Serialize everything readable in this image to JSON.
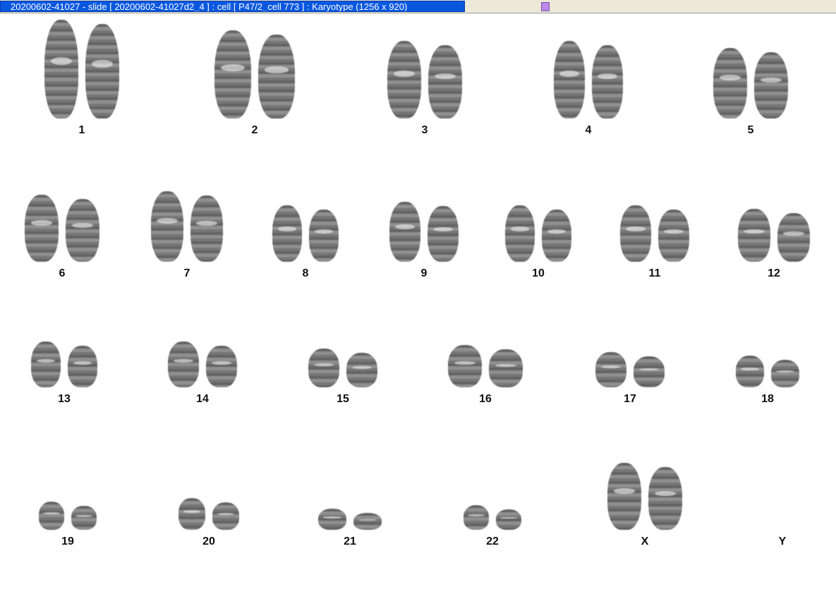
{
  "window": {
    "title": "20200602-41027 - slide [ 20200602-41027d2_4 ] : cell [ P47/2_cell 773 ] : Karyotype  (1256 x 920)"
  },
  "karyotype": {
    "labels": [
      "1",
      "2",
      "3",
      "4",
      "5",
      "6",
      "7",
      "8",
      "9",
      "10",
      "11",
      "12",
      "13",
      "14",
      "15",
      "16",
      "17",
      "18",
      "19",
      "20",
      "21",
      "22",
      "X",
      "Y"
    ],
    "chromosome_counts": {
      "1": 2,
      "2": 2,
      "3": 2,
      "4": 2,
      "5": 2,
      "6": 2,
      "7": 2,
      "8": 2,
      "9": 2,
      "10": 2,
      "11": 2,
      "12": 2,
      "13": 2,
      "14": 2,
      "15": 2,
      "16": 2,
      "17": 2,
      "18": 2,
      "19": 2,
      "20": 2,
      "21": 2,
      "22": 2,
      "X": 2,
      "Y": 0
    }
  }
}
